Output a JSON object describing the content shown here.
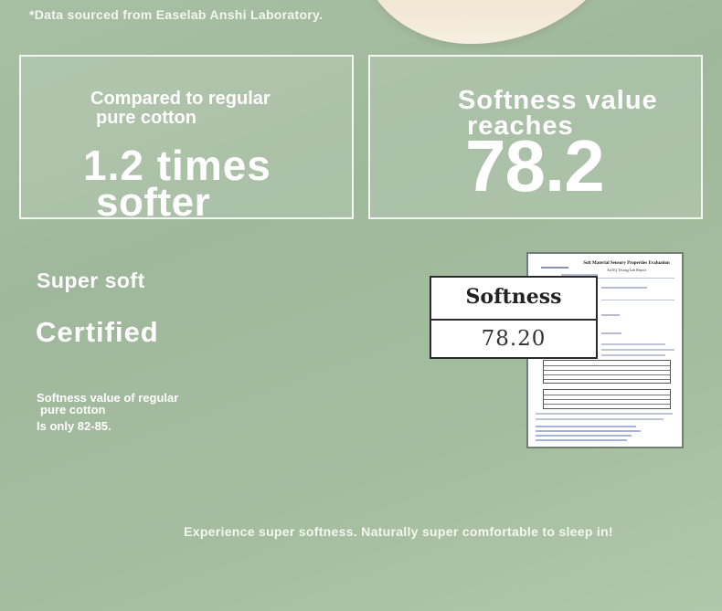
{
  "source_note": "*Data sourced from Easelab Anshi Laboratory.",
  "comparison": {
    "line1": "Compared to regular",
    "line2": "pure cotton",
    "big_line1": "1.2 times",
    "big_line2": "softer"
  },
  "softness_box": {
    "line1": "Softness value",
    "line2": "reaches",
    "value": "78.2"
  },
  "certification": {
    "title": "Super soft",
    "subtitle": "Certified",
    "regular_line1": "Softness value of regular",
    "regular_line2": "pure cotton",
    "regular_line3": "Is only 82-85."
  },
  "report": {
    "title": "Soft Material Sensory Properties Evaluation",
    "subtitle": "AnTiQ Testing Lab Report"
  },
  "softness_card": {
    "label": "Softness",
    "value": "78.20"
  },
  "tagline": "Experience super softness. Naturally super comfortable to sleep in!",
  "colors": {
    "background": "#a5bd9f",
    "text": "#ffffff",
    "cream": "#f2e6d3"
  }
}
